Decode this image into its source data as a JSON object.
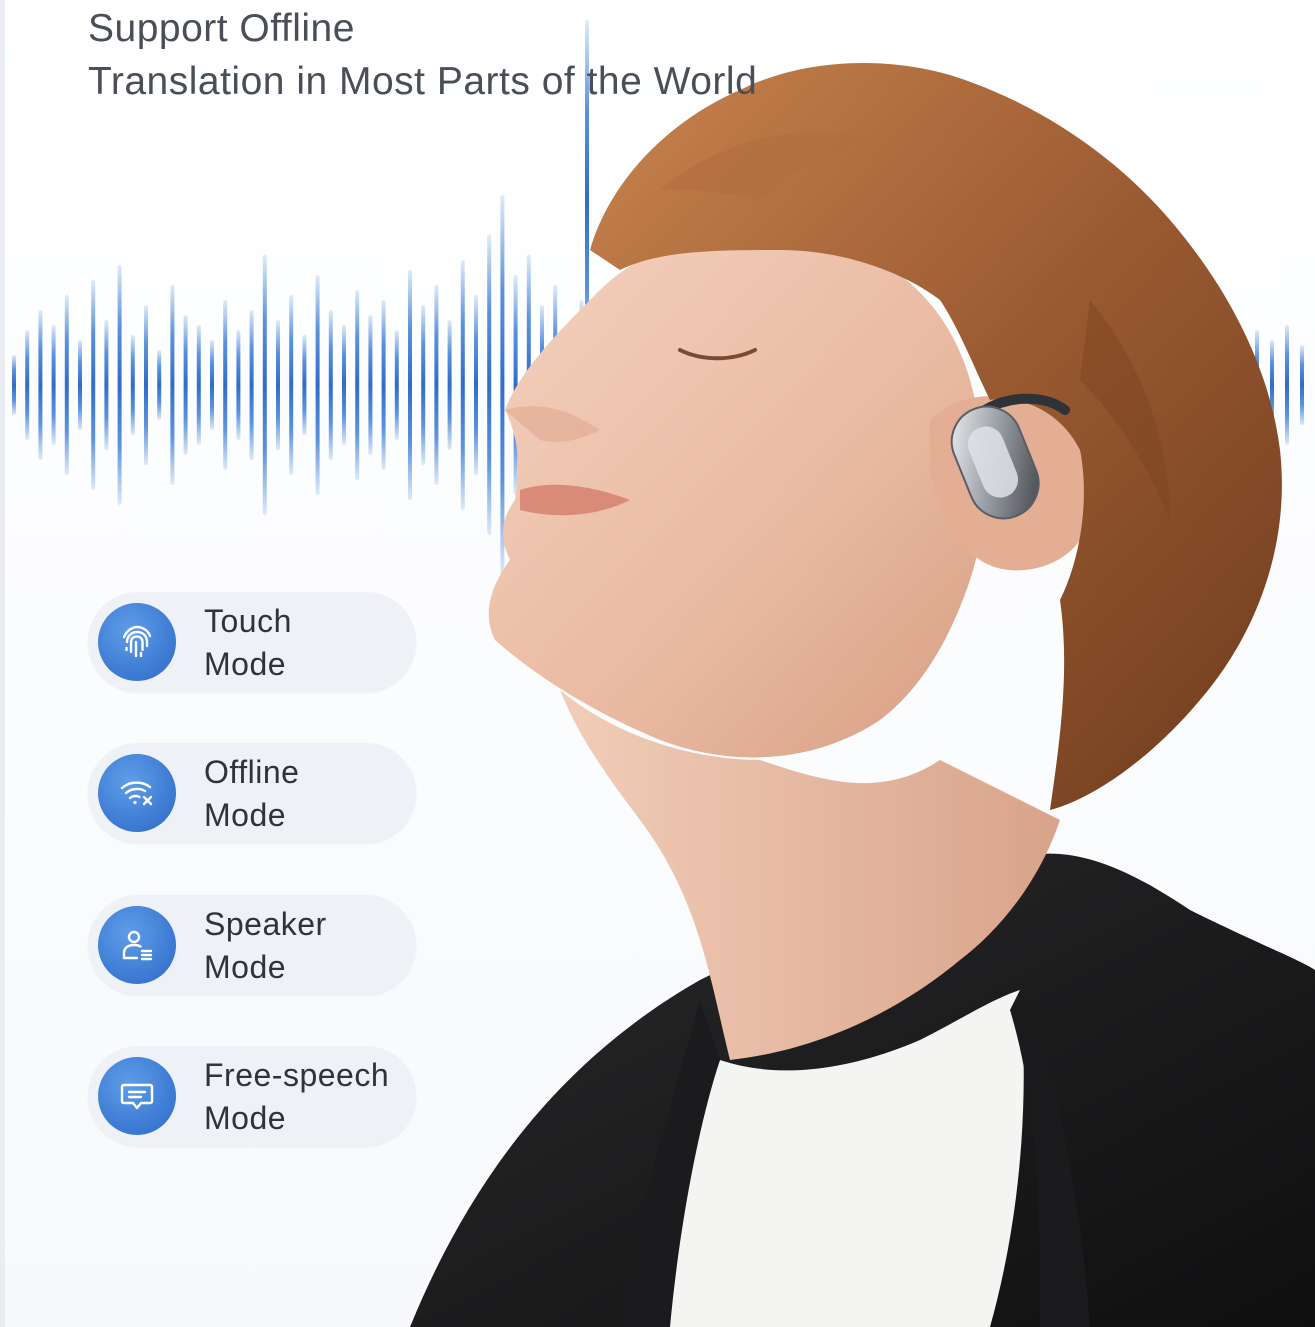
{
  "headline": {
    "line1": "Support Offline",
    "line2": "Translation in Most Parts of the World"
  },
  "modes": [
    {
      "line1": "Touch",
      "line2": "Mode",
      "icon": "fingerprint-icon"
    },
    {
      "line1": "Offline",
      "line2": "Mode",
      "icon": "wifi-off-icon"
    },
    {
      "line1": "Speaker",
      "line2": "Mode",
      "icon": "speaker-person-icon"
    },
    {
      "line1": "Free-speech",
      "line2": "Mode",
      "icon": "chat-bubble-icon"
    }
  ],
  "colors": {
    "accent_blue": "#3a78d2",
    "pill_bg": "#eef1f5",
    "text_dark": "#2f333a",
    "headline_text": "#4a4f57"
  }
}
